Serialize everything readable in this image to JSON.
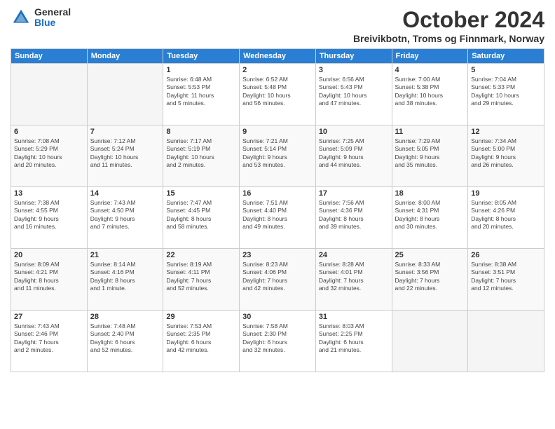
{
  "header": {
    "logo_general": "General",
    "logo_blue": "Blue",
    "month_title": "October 2024",
    "location": "Breivikbotn, Troms og Finnmark, Norway"
  },
  "columns": [
    "Sunday",
    "Monday",
    "Tuesday",
    "Wednesday",
    "Thursday",
    "Friday",
    "Saturday"
  ],
  "weeks": [
    [
      {
        "day": "",
        "info": ""
      },
      {
        "day": "",
        "info": ""
      },
      {
        "day": "1",
        "info": "Sunrise: 6:48 AM\nSunset: 5:53 PM\nDaylight: 11 hours\nand 5 minutes."
      },
      {
        "day": "2",
        "info": "Sunrise: 6:52 AM\nSunset: 5:48 PM\nDaylight: 10 hours\nand 56 minutes."
      },
      {
        "day": "3",
        "info": "Sunrise: 6:56 AM\nSunset: 5:43 PM\nDaylight: 10 hours\nand 47 minutes."
      },
      {
        "day": "4",
        "info": "Sunrise: 7:00 AM\nSunset: 5:38 PM\nDaylight: 10 hours\nand 38 minutes."
      },
      {
        "day": "5",
        "info": "Sunrise: 7:04 AM\nSunset: 5:33 PM\nDaylight: 10 hours\nand 29 minutes."
      }
    ],
    [
      {
        "day": "6",
        "info": "Sunrise: 7:08 AM\nSunset: 5:29 PM\nDaylight: 10 hours\nand 20 minutes."
      },
      {
        "day": "7",
        "info": "Sunrise: 7:12 AM\nSunset: 5:24 PM\nDaylight: 10 hours\nand 11 minutes."
      },
      {
        "day": "8",
        "info": "Sunrise: 7:17 AM\nSunset: 5:19 PM\nDaylight: 10 hours\nand 2 minutes."
      },
      {
        "day": "9",
        "info": "Sunrise: 7:21 AM\nSunset: 5:14 PM\nDaylight: 9 hours\nand 53 minutes."
      },
      {
        "day": "10",
        "info": "Sunrise: 7:25 AM\nSunset: 5:09 PM\nDaylight: 9 hours\nand 44 minutes."
      },
      {
        "day": "11",
        "info": "Sunrise: 7:29 AM\nSunset: 5:05 PM\nDaylight: 9 hours\nand 35 minutes."
      },
      {
        "day": "12",
        "info": "Sunrise: 7:34 AM\nSunset: 5:00 PM\nDaylight: 9 hours\nand 26 minutes."
      }
    ],
    [
      {
        "day": "13",
        "info": "Sunrise: 7:38 AM\nSunset: 4:55 PM\nDaylight: 9 hours\nand 16 minutes."
      },
      {
        "day": "14",
        "info": "Sunrise: 7:43 AM\nSunset: 4:50 PM\nDaylight: 9 hours\nand 7 minutes."
      },
      {
        "day": "15",
        "info": "Sunrise: 7:47 AM\nSunset: 4:45 PM\nDaylight: 8 hours\nand 58 minutes."
      },
      {
        "day": "16",
        "info": "Sunrise: 7:51 AM\nSunset: 4:40 PM\nDaylight: 8 hours\nand 49 minutes."
      },
      {
        "day": "17",
        "info": "Sunrise: 7:56 AM\nSunset: 4:36 PM\nDaylight: 8 hours\nand 39 minutes."
      },
      {
        "day": "18",
        "info": "Sunrise: 8:00 AM\nSunset: 4:31 PM\nDaylight: 8 hours\nand 30 minutes."
      },
      {
        "day": "19",
        "info": "Sunrise: 8:05 AM\nSunset: 4:26 PM\nDaylight: 8 hours\nand 20 minutes."
      }
    ],
    [
      {
        "day": "20",
        "info": "Sunrise: 8:09 AM\nSunset: 4:21 PM\nDaylight: 8 hours\nand 11 minutes."
      },
      {
        "day": "21",
        "info": "Sunrise: 8:14 AM\nSunset: 4:16 PM\nDaylight: 8 hours\nand 1 minute."
      },
      {
        "day": "22",
        "info": "Sunrise: 8:19 AM\nSunset: 4:11 PM\nDaylight: 7 hours\nand 52 minutes."
      },
      {
        "day": "23",
        "info": "Sunrise: 8:23 AM\nSunset: 4:06 PM\nDaylight: 7 hours\nand 42 minutes."
      },
      {
        "day": "24",
        "info": "Sunrise: 8:28 AM\nSunset: 4:01 PM\nDaylight: 7 hours\nand 32 minutes."
      },
      {
        "day": "25",
        "info": "Sunrise: 8:33 AM\nSunset: 3:56 PM\nDaylight: 7 hours\nand 22 minutes."
      },
      {
        "day": "26",
        "info": "Sunrise: 8:38 AM\nSunset: 3:51 PM\nDaylight: 7 hours\nand 12 minutes."
      }
    ],
    [
      {
        "day": "27",
        "info": "Sunrise: 7:43 AM\nSunset: 2:46 PM\nDaylight: 7 hours\nand 2 minutes."
      },
      {
        "day": "28",
        "info": "Sunrise: 7:48 AM\nSunset: 2:40 PM\nDaylight: 6 hours\nand 52 minutes."
      },
      {
        "day": "29",
        "info": "Sunrise: 7:53 AM\nSunset: 2:35 PM\nDaylight: 6 hours\nand 42 minutes."
      },
      {
        "day": "30",
        "info": "Sunrise: 7:58 AM\nSunset: 2:30 PM\nDaylight: 6 hours\nand 32 minutes."
      },
      {
        "day": "31",
        "info": "Sunrise: 8:03 AM\nSunset: 2:25 PM\nDaylight: 6 hours\nand 21 minutes."
      },
      {
        "day": "",
        "info": ""
      },
      {
        "day": "",
        "info": ""
      }
    ]
  ]
}
